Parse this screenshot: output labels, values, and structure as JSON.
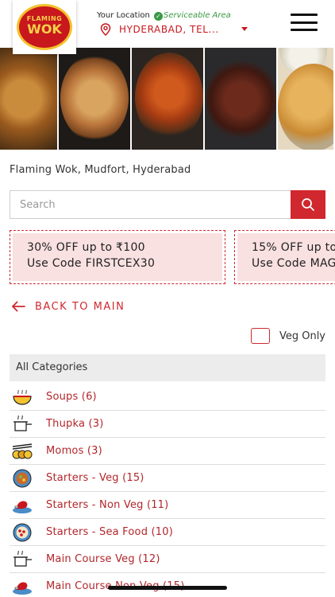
{
  "header": {
    "logo_top": "FLAMING",
    "logo_main": "WOK",
    "location_label": "Your Location",
    "serviceable_text": "Serviceable Area",
    "location_value": "HYDERABAD, TEL..."
  },
  "restaurant": {
    "name": "Flaming Wok, Mudfort, Hyderabad"
  },
  "search": {
    "placeholder": "Search"
  },
  "offers": [
    {
      "title": "30% OFF up to ₹100",
      "code": "Use Code FIRSTCEX30"
    },
    {
      "title": "15% OFF up to",
      "code": "Use Code MAG"
    }
  ],
  "nav": {
    "back_label": "BACK TO MAIN"
  },
  "filters": {
    "veg_only_label": "Veg Only",
    "veg_only_checked": false
  },
  "categories": {
    "header": "All Categories",
    "items": [
      {
        "label": "Soups (6)",
        "icon": "soup-bowl-icon"
      },
      {
        "label": "Thupka (3)",
        "icon": "cooking-pot-icon"
      },
      {
        "label": "Momos (3)",
        "icon": "momos-icon"
      },
      {
        "label": "Starters - Veg (15)",
        "icon": "veg-plate-icon"
      },
      {
        "label": "Starters - Non Veg (11)",
        "icon": "chicken-leg-icon"
      },
      {
        "label": "Starters - Sea Food (10)",
        "icon": "seafood-plate-icon"
      },
      {
        "label": "Main Course Veg (12)",
        "icon": "cooking-pot-icon"
      },
      {
        "label": "Main Course Non Veg (15)",
        "icon": "chicken-leg-icon"
      }
    ]
  },
  "colors": {
    "accent": "#d0282e",
    "accent_light": "#f9e0e1",
    "serviceable_green": "#3a9a42",
    "category_header_bg": "#ececec"
  }
}
